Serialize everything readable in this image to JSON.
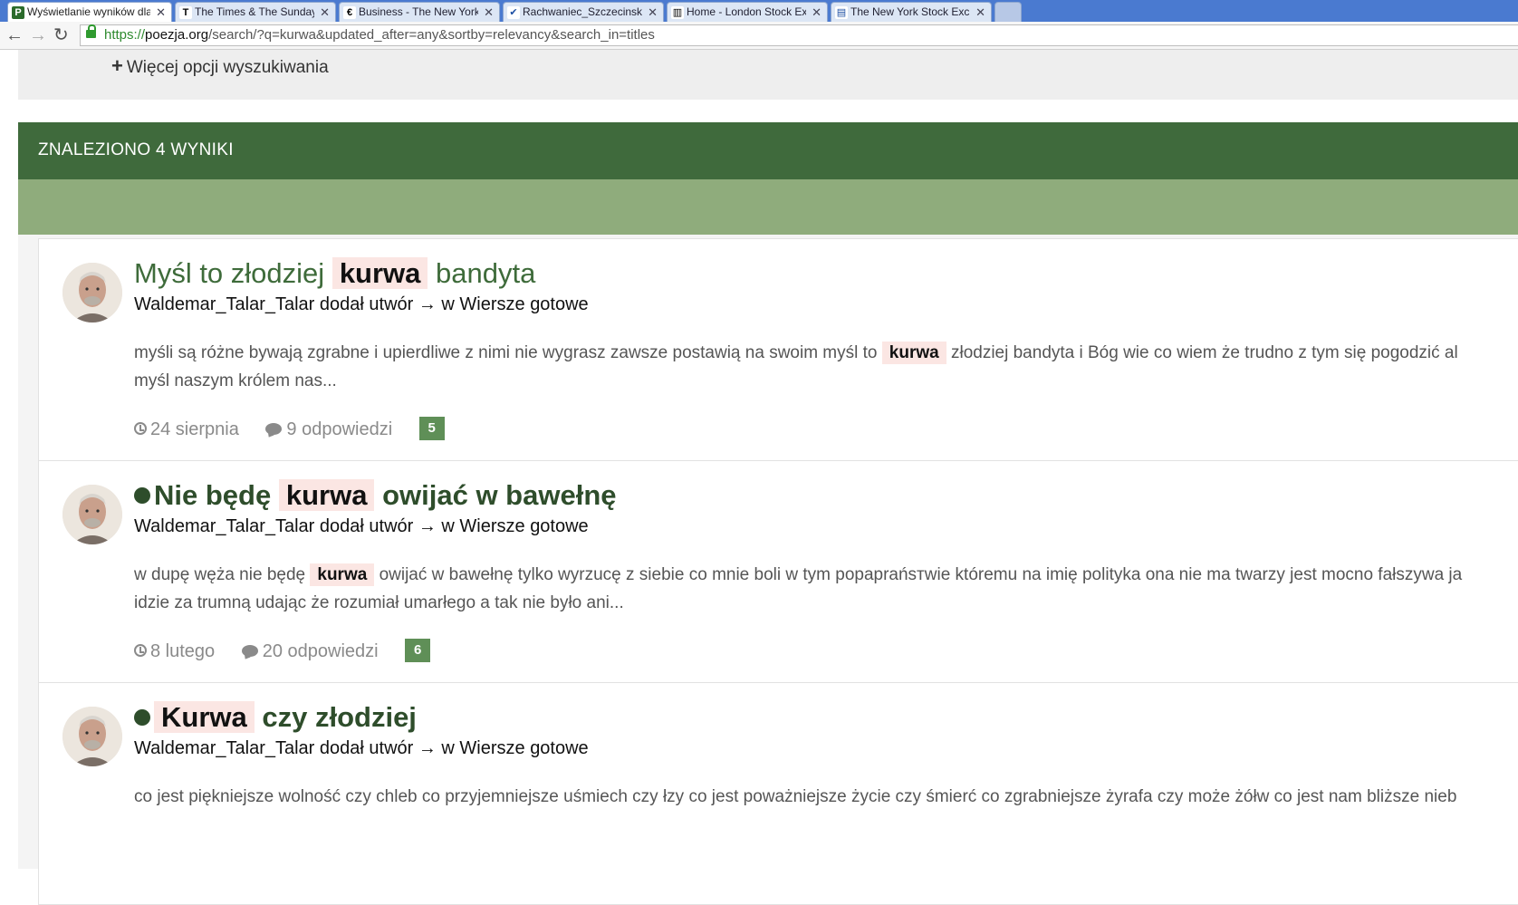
{
  "browser": {
    "tabs": [
      {
        "title": "Wyświetlanie wyników dla",
        "favicon": "P",
        "active": true
      },
      {
        "title": "The Times & The Sunday",
        "favicon": "T",
        "active": false
      },
      {
        "title": "Business - The New York T",
        "favicon": "€",
        "active": false
      },
      {
        "title": "Rachwaniec_Szczecinska_",
        "favicon": "✔",
        "active": false
      },
      {
        "title": "Home - London Stock Exc",
        "favicon": "▥",
        "active": false
      },
      {
        "title": "The New York Stock Exch",
        "favicon": "▤",
        "active": false
      }
    ],
    "url": {
      "scheme": "https://",
      "host": "poezja.org",
      "path": "/search/?q=kurwa&updated_after=any&sortby=relevancy&search_in=titles"
    }
  },
  "search": {
    "more_options_label": "Więcej opcji wyszukiwania",
    "results_header": "ZNALEZIONO 4 WYNIKI"
  },
  "results": [
    {
      "title_before": "Myśl to złodziej",
      "title_highlight": "kurwa",
      "title_after": "bandyta",
      "meta": "Waldemar_Talar_Talar dodał utwór → w Wiersze gotowe",
      "snippet_line1_before": "myśli są różne bywają zgrabne i upierdliwe z nimi nie wygrasz zawsze postawią na swoim myśl to",
      "snippet_highlight": "kurwa",
      "snippet_line1_after": "złodziej bandyta i Bóg wie co wiem że trudno z tym się pogodzić al",
      "snippet_line2": "myśl naszym królem nas...",
      "date": "24 sierpnia",
      "replies": "9 odpowiedzi",
      "score": "5"
    },
    {
      "title_before": "Nie będę",
      "title_highlight": "kurwa",
      "title_after": "owijać w bawełnę",
      "meta": "Waldemar_Talar_Talar dodał utwór → w Wiersze gotowe",
      "snippet_line1_before": "w dupę węża nie będę",
      "snippet_highlight": "kurwa",
      "snippet_line1_after": "owijać w bawełnę tylko wyrzucę z siebie co mnie boli w tym popaprańsтwie któremu na imię polityka ona nie ma twarzy jest mocno fałszywa ja",
      "snippet_line2": "idzie za trumną udając że rozumiał umarłego a tak nie było ani...",
      "date": "8 lutego",
      "replies": "20 odpowiedzi",
      "score": "6"
    },
    {
      "title_before": "",
      "title_highlight": "Kurwa",
      "title_after": "czy złodziej",
      "meta": "Waldemar_Talar_Talar dodał utwór → w Wiersze gotowe",
      "snippet_line1_before": "co jest piękniejsze wolność czy chleb co przyjemniejsze uśmiech czy łzy co jest poważniejsze życie czy śmierć co zgrabniejsze żyrafa czy może żółw co jest nam bliższe nieb"
    }
  ]
}
